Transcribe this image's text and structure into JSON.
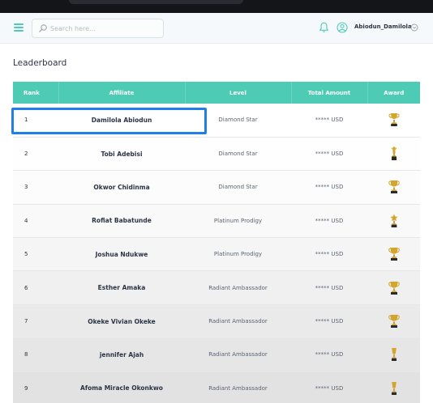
{
  "header": {
    "search_placeholder": "Search here...",
    "username": "Abiodun_Damilola",
    "icons": [
      "menu-icon",
      "search-icon",
      "bell-icon",
      "user-icon",
      "chevron-down-icon"
    ]
  },
  "page": {
    "title": "Leaderboard"
  },
  "table": {
    "columns": [
      "Rank",
      "Affiliate",
      "Level",
      "Total Amount",
      "Award"
    ],
    "rows": [
      {
        "rank": "1",
        "affiliate": "Damilola Abiodun",
        "level": "Diamond Star",
        "amount": "***** USD",
        "award": "trophy-icon"
      },
      {
        "rank": "2",
        "affiliate": "Tobi Adebisi",
        "level": "Diamond Star",
        "amount": "***** USD",
        "award": "figure-trophy-icon"
      },
      {
        "rank": "3",
        "affiliate": "Okwor Chidinma",
        "level": "Diamond Star",
        "amount": "***** USD",
        "award": "trophy-icon"
      },
      {
        "rank": "4",
        "affiliate": "Rofiat Babatunde",
        "level": "Platinum Prodigy",
        "amount": "***** USD",
        "award": "star-trophy-icon"
      },
      {
        "rank": "5",
        "affiliate": "Joshua Ndukwe",
        "level": "Platinum Prodigy",
        "amount": "***** USD",
        "award": "trophy-icon"
      },
      {
        "rank": "6",
        "affiliate": "Esther Amaka",
        "level": "Radiant Ambassador",
        "amount": "***** USD",
        "award": "trophy-icon"
      },
      {
        "rank": "7",
        "affiliate": "Okeke Vivian Okeke",
        "level": "Radiant Ambassador",
        "amount": "***** USD",
        "award": "trophy-icon"
      },
      {
        "rank": "8",
        "affiliate": "jennifer Ajah",
        "level": "Radiant Ambassador",
        "amount": "***** USD",
        "award": "slim-trophy-icon"
      },
      {
        "rank": "9",
        "affiliate": "Afoma Miracle Okonkwo",
        "level": "Radiant Ambassador",
        "amount": "***** USD",
        "award": "slim-trophy-icon"
      }
    ]
  },
  "colors": {
    "accent": "#4ecbb5",
    "highlight_border": "#1f7ee8",
    "trophy_gold": "#d4a52c",
    "trophy_base": "#2b2b2b"
  }
}
